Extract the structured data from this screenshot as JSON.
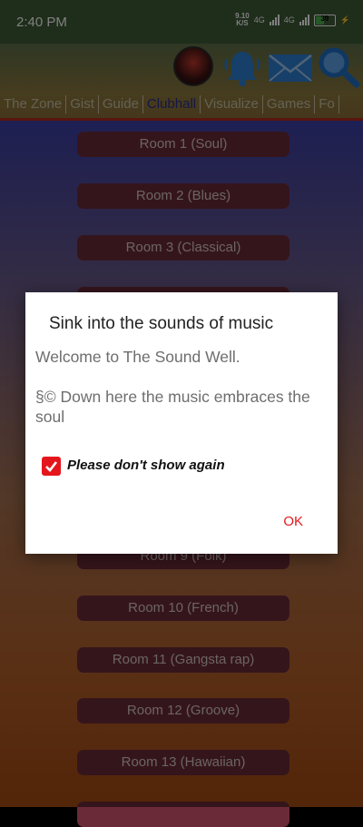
{
  "status_bar": {
    "time": "2:40 PM",
    "speed_value": "9.10",
    "speed_unit": "K/S",
    "net1": "4G",
    "net2": "4G",
    "battery": "39"
  },
  "header_icons": [
    "avatar",
    "bell-icon",
    "mail-icon",
    "search-icon"
  ],
  "tabs": [
    {
      "label": "The Zone",
      "active": false
    },
    {
      "label": "Gist",
      "active": false
    },
    {
      "label": "Guide",
      "active": false
    },
    {
      "label": "Clubhall",
      "active": true
    },
    {
      "label": "Visualize",
      "active": false
    },
    {
      "label": "Games",
      "active": false
    },
    {
      "label": "Fo",
      "active": false
    }
  ],
  "rooms": [
    "Room 1 (Soul)",
    "Room 2 (Blues)",
    "Room 3 (Classical)",
    "Room 9 (Folk)",
    "Room 10 (French)",
    "Room 11 (Gangsta rap)",
    "Room 12 (Groove)",
    "Room 13 (Hawaiian)"
  ],
  "dialog": {
    "title": "Sink into the sounds of music",
    "message_line1": "Welcome to The Sound Well.",
    "message_line2": "§© Down here the music embraces the soul",
    "checkbox_label": "Please don't show again",
    "checkbox_checked": true,
    "ok_label": "OK"
  },
  "colors": {
    "accent": "#e5161b",
    "active_tab": "#2b2f8a",
    "room_button": "#6b2a38"
  }
}
